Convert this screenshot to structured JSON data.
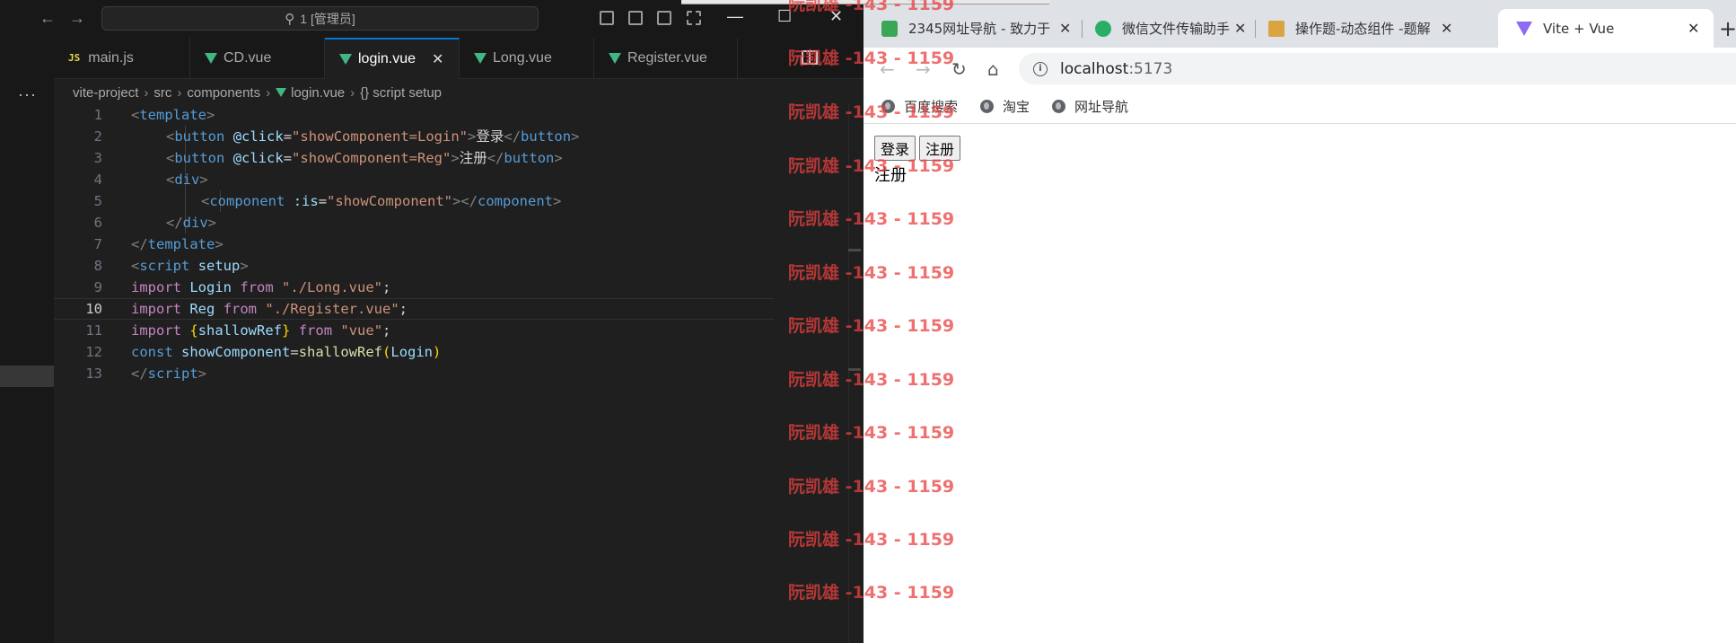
{
  "editor": {
    "command_center": "1 [管理员]",
    "tabs": [
      {
        "label": "main.js",
        "type": "js"
      },
      {
        "label": "CD.vue",
        "type": "vue"
      },
      {
        "label": "login.vue",
        "type": "vue",
        "active": true
      },
      {
        "label": "Long.vue",
        "type": "vue"
      },
      {
        "label": "Register.vue",
        "type": "vue"
      }
    ],
    "breadcrumb": [
      "vite-project",
      "src",
      "components",
      "login.vue",
      "{} script setup"
    ],
    "line_numbers": [
      "1",
      "2",
      "3",
      "4",
      "5",
      "6",
      "7",
      "8",
      "9",
      "10",
      "11",
      "12",
      "13"
    ],
    "current_line": 10,
    "code": [
      [
        "<",
        "template",
        ">"
      ],
      [
        "<",
        "button",
        " ",
        "@click",
        "=",
        "\"showComponent=Login\"",
        ">",
        "登录",
        "</",
        "button",
        ">"
      ],
      [
        "<",
        "button",
        " ",
        "@click",
        "=",
        "\"showComponent=Reg\"",
        ">",
        "注册",
        "</",
        "button",
        ">"
      ],
      [
        "<",
        "div",
        ">"
      ],
      [
        "<",
        "component",
        " ",
        ":is",
        "=",
        "\"showComponent\"",
        "></",
        "component",
        ">"
      ],
      [
        "</",
        "div",
        ">"
      ],
      [
        "</",
        "template",
        ">"
      ],
      [
        "<",
        "script",
        " ",
        "setup",
        ">"
      ],
      [
        "import",
        " ",
        "Login",
        " ",
        "from",
        " ",
        "\"./Long.vue\"",
        ";"
      ],
      [
        "import",
        " ",
        "Reg",
        " ",
        "from",
        " ",
        "\"./Register.vue\"",
        ";"
      ],
      [
        "import",
        " ",
        "{",
        "shallowRef",
        "}",
        " ",
        "from",
        " ",
        "\"vue\"",
        ";"
      ],
      [
        "const",
        " ",
        "showComponent",
        "=",
        "shallowRef",
        "(",
        "Login",
        ")"
      ],
      [
        "</",
        "script",
        ">"
      ]
    ]
  },
  "browser": {
    "tabs": [
      {
        "label": "2345网址导航 - 致力于",
        "favicon": "2345-icon"
      },
      {
        "label": "微信文件传输助手网页",
        "favicon": "wechat-icon"
      },
      {
        "label": "操作题-动态组件 -题解",
        "favicon": "image-icon"
      },
      {
        "label": "Vite + Vue",
        "favicon": "vite-icon",
        "active": true
      }
    ],
    "url_host": "localhost",
    "url_port": ":5173",
    "bookmarks": [
      "百度搜索",
      "淘宝",
      "网址导航"
    ],
    "page": {
      "login_button": "登录",
      "register_button": "注册",
      "component_text": "注册"
    }
  },
  "watermark": "阮凯雄 -143 - 1159",
  "colors": {
    "accent": "#0078d4",
    "vue": "#41b883",
    "watermark": "#e84040"
  }
}
